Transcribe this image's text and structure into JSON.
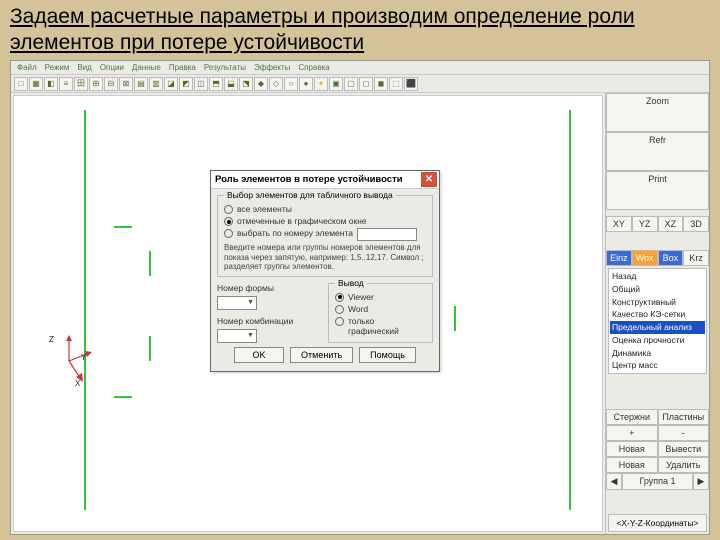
{
  "slide_title": "Задаем расчетные параметры и производим определение роли элементов при потере устойчивости",
  "menubar": {
    "items": [
      "Файл",
      "Режим",
      "Вид",
      "Опции",
      "Данные",
      "Правка",
      "Результаты",
      "Эффекты",
      "Справка"
    ]
  },
  "right": {
    "zoom": "Zoom",
    "refr": "Refr",
    "print": "Print",
    "views": [
      "XY",
      "YZ",
      "XZ",
      "3D"
    ],
    "filters": [
      "Einz",
      "Wox",
      "Box",
      "Krz"
    ],
    "modes": [
      "Назад",
      "Общий",
      "Конструктивный",
      "Качество КЭ-сетки",
      "Предельный анализ",
      "Оценка прочности",
      "Динамика",
      "Центр масс"
    ],
    "selected_mode_index": 4,
    "grid": {
      "r1": [
        "Стержни",
        "Пластины"
      ],
      "r2": [
        "+",
        "-"
      ],
      "r3": [
        "Новая",
        "Вывести"
      ],
      "r4": [
        "Новая",
        "Удалить"
      ]
    },
    "group_nav": {
      "left": "◀",
      "label": "Группа 1",
      "right": "▶"
    },
    "status": "<X-Y-Z-Координаты>"
  },
  "dialog": {
    "title": "Роль элементов в потере устойчивости",
    "group1_title": "Выбор элементов для табличного вывода",
    "radios": {
      "r1": "все элементы",
      "r2": "отмеченные в графическом окне",
      "r3": "выбрать по номеру элемента"
    },
    "hint": "Введите номера или группы номеров элементов для показа через запятую, например: 1,5..12,17. Символ ; разделяет группы элементов.",
    "form_label": "Номер формы",
    "combo_label": "Номер комбинации",
    "output_title": "Вывод",
    "out": {
      "viewer": "Viewer",
      "word": "Word",
      "gfx": "только графический"
    },
    "buttons": {
      "ok": "OK",
      "cancel": "Отменить",
      "help": "Помощь"
    }
  },
  "axis": {
    "x": "X",
    "y": "Y",
    "z": "Z"
  }
}
